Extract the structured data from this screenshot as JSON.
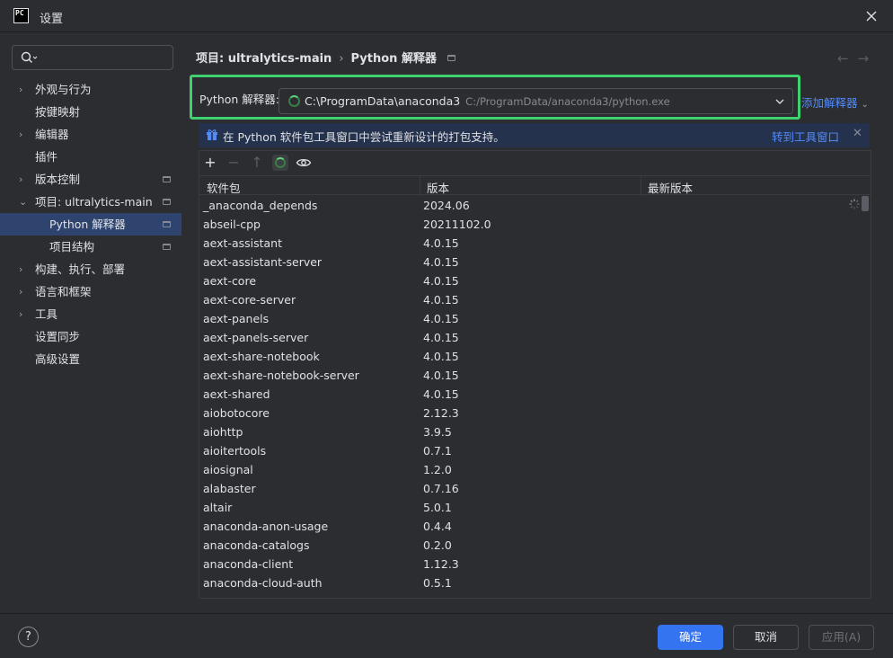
{
  "window": {
    "title": "设置",
    "logo_text": "PC"
  },
  "sidebar": {
    "search_placeholder": "",
    "items": [
      {
        "label": "外观与行为",
        "expandable": true
      },
      {
        "label": "按键映射",
        "expandable": false
      },
      {
        "label": "编辑器",
        "expandable": true
      },
      {
        "label": "插件",
        "expandable": false
      },
      {
        "label": "版本控制",
        "expandable": true,
        "pinned": true
      },
      {
        "label": "项目: ultralytics-main",
        "expandable": true,
        "expanded": true,
        "pinned": true
      },
      {
        "label": "Python 解释器",
        "sub": true,
        "selected": true,
        "pinned": true
      },
      {
        "label": "项目结构",
        "sub": true,
        "pinned": true
      },
      {
        "label": "构建、执行、部署",
        "expandable": true
      },
      {
        "label": "语言和框架",
        "expandable": true
      },
      {
        "label": "工具",
        "expandable": true
      },
      {
        "label": "设置同步",
        "expandable": false
      },
      {
        "label": "高级设置",
        "expandable": false
      }
    ]
  },
  "breadcrumb": {
    "project": "项目: ultralytics-main",
    "separator": "›",
    "page": "Python 解释器"
  },
  "interpreter": {
    "label": "Python 解释器:",
    "name": "C:\\ProgramData\\anaconda3",
    "path": "C:/ProgramData/anaconda3/python.exe",
    "add_label": "添加解释器"
  },
  "banner": {
    "message": "在 Python 软件包工具窗口中尝试重新设计的打包支持。",
    "link": "转到工具窗口"
  },
  "table": {
    "headers": [
      "软件包",
      "版本",
      "最新版本"
    ],
    "rows": [
      [
        "_anaconda_depends",
        "2024.06",
        ""
      ],
      [
        "abseil-cpp",
        "20211102.0",
        ""
      ],
      [
        "aext-assistant",
        "4.0.15",
        ""
      ],
      [
        "aext-assistant-server",
        "4.0.15",
        ""
      ],
      [
        "aext-core",
        "4.0.15",
        ""
      ],
      [
        "aext-core-server",
        "4.0.15",
        ""
      ],
      [
        "aext-panels",
        "4.0.15",
        ""
      ],
      [
        "aext-panels-server",
        "4.0.15",
        ""
      ],
      [
        "aext-share-notebook",
        "4.0.15",
        ""
      ],
      [
        "aext-share-notebook-server",
        "4.0.15",
        ""
      ],
      [
        "aext-shared",
        "4.0.15",
        ""
      ],
      [
        "aiobotocore",
        "2.12.3",
        ""
      ],
      [
        "aiohttp",
        "3.9.5",
        ""
      ],
      [
        "aioitertools",
        "0.7.1",
        ""
      ],
      [
        "aiosignal",
        "1.2.0",
        ""
      ],
      [
        "alabaster",
        "0.7.16",
        ""
      ],
      [
        "altair",
        "5.0.1",
        ""
      ],
      [
        "anaconda-anon-usage",
        "0.4.4",
        ""
      ],
      [
        "anaconda-catalogs",
        "0.2.0",
        ""
      ],
      [
        "anaconda-client",
        "1.12.3",
        ""
      ],
      [
        "anaconda-cloud-auth",
        "0.5.1",
        ""
      ]
    ]
  },
  "buttons": {
    "help": "?",
    "ok": "确定",
    "cancel": "取消",
    "apply": "应用(A)"
  },
  "colors": {
    "accent": "#3574f0",
    "highlight_box": "#3fd16f",
    "link": "#548af7",
    "selection": "#2e436e"
  }
}
